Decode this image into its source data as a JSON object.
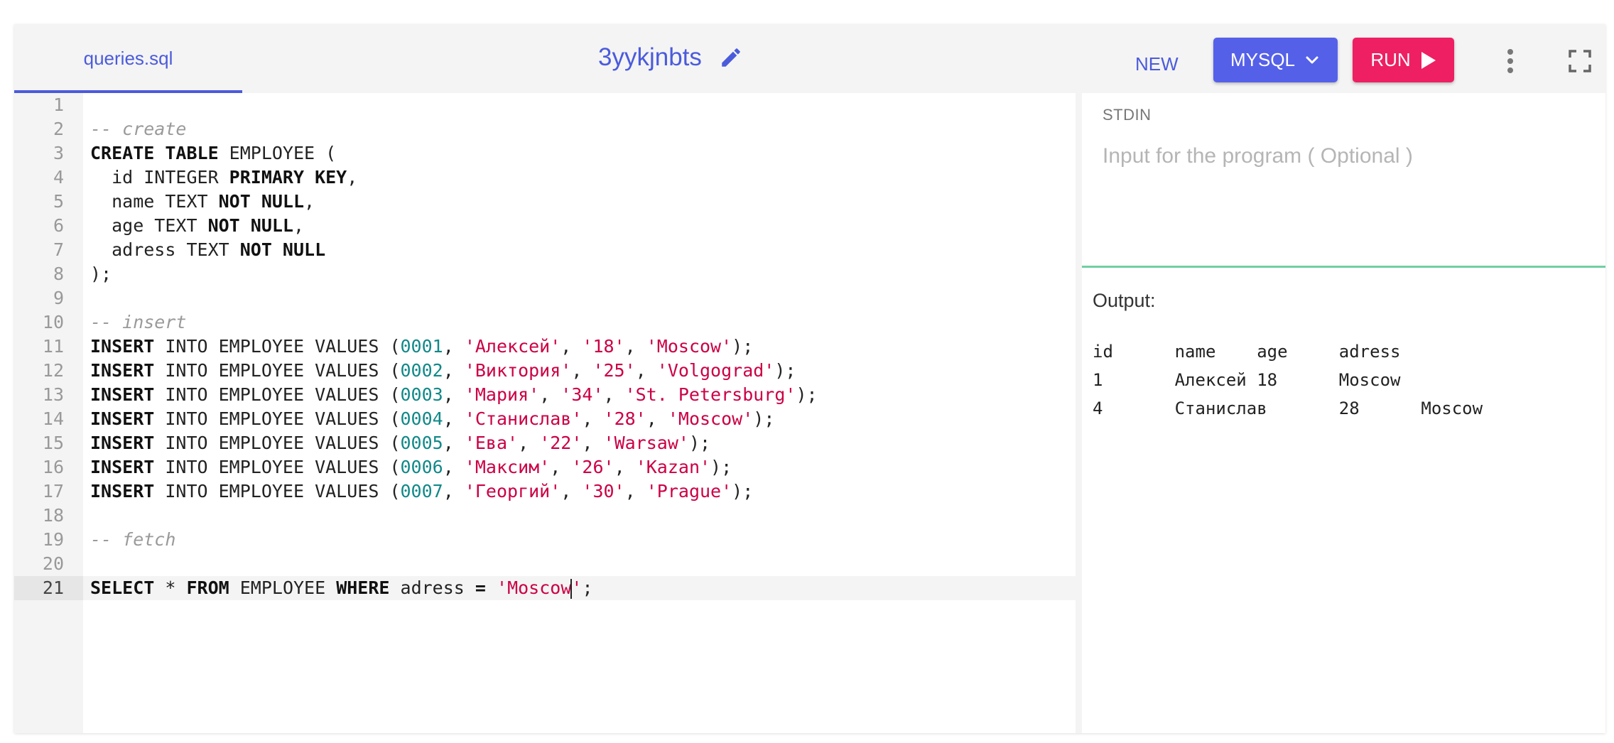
{
  "tab": {
    "label": "queries.sql"
  },
  "title": "3yykjnbts",
  "toolbar": {
    "new_label": "NEW",
    "mysql_label": "MYSQL",
    "run_label": "RUN"
  },
  "editor": {
    "lines": [
      [],
      [
        {
          "t": "-- create",
          "c": "cm"
        }
      ],
      [
        {
          "t": "CREATE TABLE",
          "c": "kw"
        },
        {
          "t": " EMPLOYEE (",
          "c": ""
        }
      ],
      [
        {
          "t": "  id INTEGER ",
          "c": ""
        },
        {
          "t": "PRIMARY KEY",
          "c": "kw"
        },
        {
          "t": ",",
          "c": ""
        }
      ],
      [
        {
          "t": "  name TEXT ",
          "c": ""
        },
        {
          "t": "NOT NULL",
          "c": "kw"
        },
        {
          "t": ",",
          "c": ""
        }
      ],
      [
        {
          "t": "  age TEXT ",
          "c": ""
        },
        {
          "t": "NOT NULL",
          "c": "kw"
        },
        {
          "t": ",",
          "c": ""
        }
      ],
      [
        {
          "t": "  adress TEXT ",
          "c": ""
        },
        {
          "t": "NOT NULL",
          "c": "kw"
        }
      ],
      [
        {
          "t": ");",
          "c": ""
        }
      ],
      [],
      [
        {
          "t": "-- insert",
          "c": "cm"
        }
      ],
      [
        {
          "t": "INSERT",
          "c": "kw"
        },
        {
          "t": " INTO EMPLOYEE VALUES (",
          "c": ""
        },
        {
          "t": "0001",
          "c": "nm"
        },
        {
          "t": ", ",
          "c": ""
        },
        {
          "t": "'Алексей'",
          "c": "st"
        },
        {
          "t": ", ",
          "c": ""
        },
        {
          "t": "'18'",
          "c": "st"
        },
        {
          "t": ", ",
          "c": ""
        },
        {
          "t": "'Moscow'",
          "c": "st"
        },
        {
          "t": ");",
          "c": ""
        }
      ],
      [
        {
          "t": "INSERT",
          "c": "kw"
        },
        {
          "t": " INTO EMPLOYEE VALUES (",
          "c": ""
        },
        {
          "t": "0002",
          "c": "nm"
        },
        {
          "t": ", ",
          "c": ""
        },
        {
          "t": "'Виктория'",
          "c": "st"
        },
        {
          "t": ", ",
          "c": ""
        },
        {
          "t": "'25'",
          "c": "st"
        },
        {
          "t": ", ",
          "c": ""
        },
        {
          "t": "'Volgograd'",
          "c": "st"
        },
        {
          "t": ");",
          "c": ""
        }
      ],
      [
        {
          "t": "INSERT",
          "c": "kw"
        },
        {
          "t": " INTO EMPLOYEE VALUES (",
          "c": ""
        },
        {
          "t": "0003",
          "c": "nm"
        },
        {
          "t": ", ",
          "c": ""
        },
        {
          "t": "'Мария'",
          "c": "st"
        },
        {
          "t": ", ",
          "c": ""
        },
        {
          "t": "'34'",
          "c": "st"
        },
        {
          "t": ", ",
          "c": ""
        },
        {
          "t": "'St. Petersburg'",
          "c": "st"
        },
        {
          "t": ");",
          "c": ""
        }
      ],
      [
        {
          "t": "INSERT",
          "c": "kw"
        },
        {
          "t": " INTO EMPLOYEE VALUES (",
          "c": ""
        },
        {
          "t": "0004",
          "c": "nm"
        },
        {
          "t": ", ",
          "c": ""
        },
        {
          "t": "'Станислав'",
          "c": "st"
        },
        {
          "t": ", ",
          "c": ""
        },
        {
          "t": "'28'",
          "c": "st"
        },
        {
          "t": ", ",
          "c": ""
        },
        {
          "t": "'Moscow'",
          "c": "st"
        },
        {
          "t": ");",
          "c": ""
        }
      ],
      [
        {
          "t": "INSERT",
          "c": "kw"
        },
        {
          "t": " INTO EMPLOYEE VALUES (",
          "c": ""
        },
        {
          "t": "0005",
          "c": "nm"
        },
        {
          "t": ", ",
          "c": ""
        },
        {
          "t": "'Ева'",
          "c": "st"
        },
        {
          "t": ", ",
          "c": ""
        },
        {
          "t": "'22'",
          "c": "st"
        },
        {
          "t": ", ",
          "c": ""
        },
        {
          "t": "'Warsaw'",
          "c": "st"
        },
        {
          "t": ");",
          "c": ""
        }
      ],
      [
        {
          "t": "INSERT",
          "c": "kw"
        },
        {
          "t": " INTO EMPLOYEE VALUES (",
          "c": ""
        },
        {
          "t": "0006",
          "c": "nm"
        },
        {
          "t": ", ",
          "c": ""
        },
        {
          "t": "'Максим'",
          "c": "st"
        },
        {
          "t": ", ",
          "c": ""
        },
        {
          "t": "'26'",
          "c": "st"
        },
        {
          "t": ", ",
          "c": ""
        },
        {
          "t": "'Kazan'",
          "c": "st"
        },
        {
          "t": ");",
          "c": ""
        }
      ],
      [
        {
          "t": "INSERT",
          "c": "kw"
        },
        {
          "t": " INTO EMPLOYEE VALUES (",
          "c": ""
        },
        {
          "t": "0007",
          "c": "nm"
        },
        {
          "t": ", ",
          "c": ""
        },
        {
          "t": "'Георгий'",
          "c": "st"
        },
        {
          "t": ", ",
          "c": ""
        },
        {
          "t": "'30'",
          "c": "st"
        },
        {
          "t": ", ",
          "c": ""
        },
        {
          "t": "'Prague'",
          "c": "st"
        },
        {
          "t": ");",
          "c": ""
        }
      ],
      [],
      [
        {
          "t": "-- fetch",
          "c": "cm"
        }
      ],
      [],
      [
        {
          "t": "SELECT",
          "c": "kw"
        },
        {
          "t": " * ",
          "c": ""
        },
        {
          "t": "FROM",
          "c": "kw"
        },
        {
          "t": " EMPLOYEE ",
          "c": ""
        },
        {
          "t": "WHERE",
          "c": "kw"
        },
        {
          "t": " adress ",
          "c": ""
        },
        {
          "t": "=",
          "c": "kw"
        },
        {
          "t": " ",
          "c": ""
        },
        {
          "t": "'Moscow",
          "c": "st"
        },
        {
          "t": "",
          "c": "caret"
        },
        {
          "t": "'",
          "c": "st"
        },
        {
          "t": ";",
          "c": ""
        }
      ]
    ],
    "active_line": 21
  },
  "stdin": {
    "label": "STDIN",
    "placeholder": "Input for the program ( Optional )"
  },
  "output": {
    "label": "Output:",
    "lines": [
      "id\tname\tage\tadress",
      "1\tАлексей\t18\tMoscow",
      "4\tСтанислав\t28\tMoscow"
    ]
  },
  "icons": {
    "edit": "pencil-icon",
    "dropdown": "chevron-down-icon",
    "run": "play-icon",
    "more": "more-vertical-icon",
    "fullscreen": "fullscreen-icon"
  },
  "colors": {
    "accent": "#4b5bdc",
    "mysql_button": "#5560e9",
    "run_button": "#ee1f63",
    "divider": "#6fd0a1"
  }
}
